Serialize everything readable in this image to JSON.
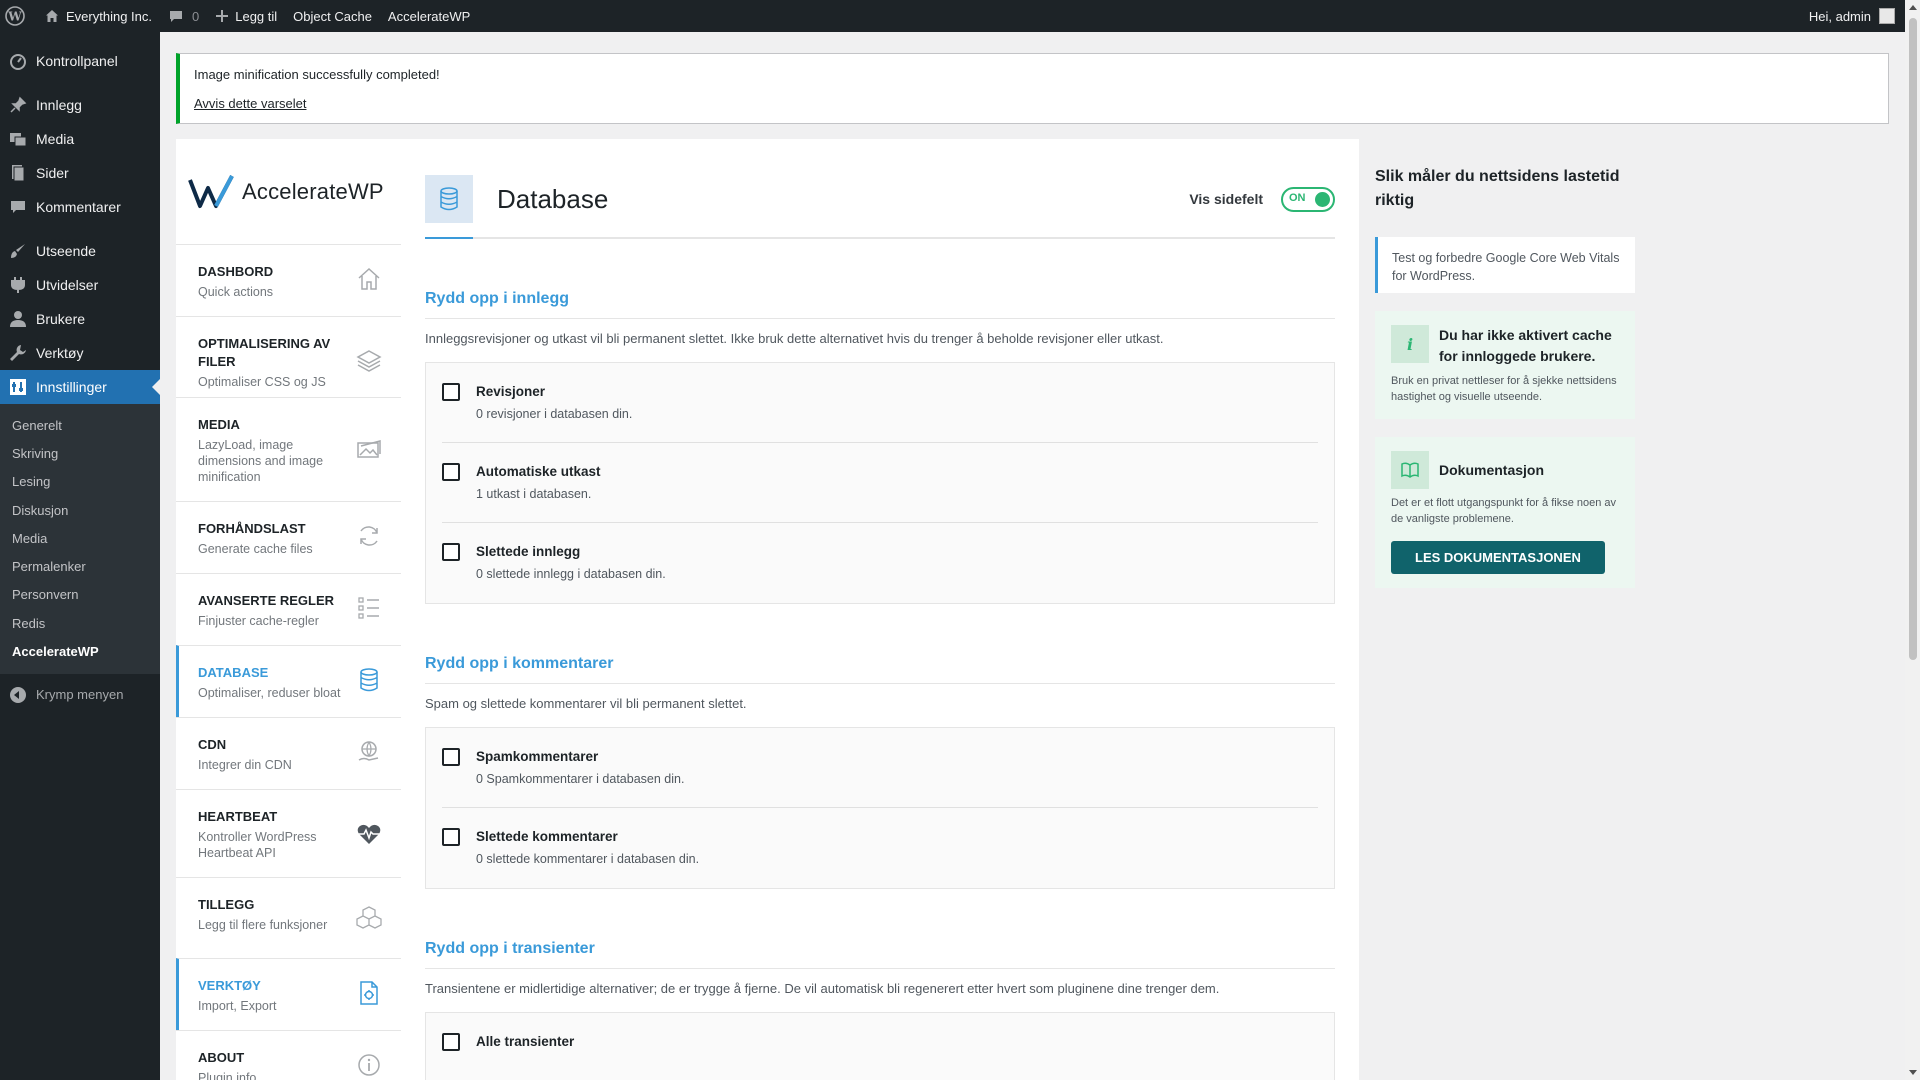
{
  "adminbar": {
    "site_name": "Everything Inc.",
    "comments_count": "0",
    "new_label": "Legg til",
    "object_cache_label": "Object Cache",
    "acceleratewp_label": "AccelerateWP",
    "greeting": "Hei, admin"
  },
  "adminmenu": {
    "items": [
      {
        "label": "Kontrollpanel",
        "icon": "dashboard-icon"
      },
      {
        "label": "Innlegg",
        "icon": "pin-icon"
      },
      {
        "label": "Media",
        "icon": "media-icon"
      },
      {
        "label": "Sider",
        "icon": "page-icon"
      },
      {
        "label": "Kommentarer",
        "icon": "comment-icon"
      },
      {
        "label": "Utseende",
        "icon": "brush-icon"
      },
      {
        "label": "Utvidelser",
        "icon": "plugin-icon"
      },
      {
        "label": "Brukere",
        "icon": "user-icon"
      },
      {
        "label": "Verktøy",
        "icon": "wrench-icon"
      },
      {
        "label": "Innstillinger",
        "icon": "settings-icon"
      }
    ],
    "submenu": [
      "Generelt",
      "Skriving",
      "Lesing",
      "Diskusjon",
      "Media",
      "Permalenker",
      "Personvern",
      "Redis",
      "AccelerateWP"
    ],
    "collapse_label": "Krymp menyen"
  },
  "notice": {
    "message": "Image minification successfully completed!",
    "dismiss": "Avvis dette varselet"
  },
  "plugin": {
    "logo_text": "AccelerateWP",
    "nav": [
      {
        "title": "DASHBORD",
        "desc": "Quick actions",
        "icon": "home-icon"
      },
      {
        "title": "OPTIMALISERING AV FILER",
        "desc": "Optimaliser CSS og JS",
        "icon": "layers-icon"
      },
      {
        "title": "MEDIA",
        "desc": "LazyLoad, image dimensions and image minification",
        "icon": "image-icon"
      },
      {
        "title": "FORHÅNDSLAST",
        "desc": "Generate cache files",
        "icon": "refresh-icon"
      },
      {
        "title": "AVANSERTE REGLER",
        "desc": "Finjuster cache-regler",
        "icon": "list-icon"
      },
      {
        "title": "DATABASE",
        "desc": "Optimaliser, reduser bloat",
        "icon": "database-icon"
      },
      {
        "title": "CDN",
        "desc": "Integrer din CDN",
        "icon": "globe-hand-icon"
      },
      {
        "title": "HEARTBEAT",
        "desc": "Kontroller WordPress Heartbeat API",
        "icon": "heartbeat-icon"
      },
      {
        "title": "TILLEGG",
        "desc": "Legg til flere funksjoner",
        "icon": "cubes-icon"
      },
      {
        "title": "VERKTØY",
        "desc": "Import, Export",
        "icon": "tools-doc-icon"
      },
      {
        "title": "ABOUT",
        "desc": "Plugin info",
        "icon": "info-icon"
      }
    ]
  },
  "main": {
    "title": "Database",
    "sidebar_toggle_label": "Vis sidefelt",
    "toggle_state": "ON",
    "sections": [
      {
        "heading": "Rydd opp i innlegg",
        "desc": "Innleggsrevisjoner og utkast vil bli permanent slettet. Ikke bruk dette alternativet hvis du trenger å beholde revisjoner eller utkast.",
        "options": [
          {
            "title": "Revisjoner",
            "desc": "0 revisjoner i databasen din."
          },
          {
            "title": "Automatiske utkast",
            "desc": "1 utkast i databasen."
          },
          {
            "title": "Slettede innlegg",
            "desc": "0 slettede innlegg i databasen din."
          }
        ]
      },
      {
        "heading": "Rydd opp i kommentarer",
        "desc": "Spam og slettede kommentarer vil bli permanent slettet.",
        "options": [
          {
            "title": "Spamkommentarer",
            "desc": "0 Spamkommentarer i databasen din."
          },
          {
            "title": "Slettede kommentarer",
            "desc": "0 slettede kommentarer i databasen din."
          }
        ]
      },
      {
        "heading": "Rydd opp i transienter",
        "desc": "Transientene er midlertidige alternativer; de er trygge å fjerne. De vil automatisk bli regenerert etter hvert som pluginene dine trenger dem.",
        "options": [
          {
            "title": "Alle transienter",
            "desc": ""
          }
        ]
      }
    ]
  },
  "side": {
    "title": "Slik måler du nettsidens lastetid riktig",
    "card1": "Test og forbedre Google Core Web Vitals for WordPress.",
    "card2": {
      "title": "Du har ikke aktivert cache for innloggede brukere.",
      "desc": "Bruk en privat nettleser for å sjekke nettsidens hastighet og visuelle utseende.",
      "icon_glyph": "i"
    },
    "card3": {
      "title": "Dokumentasjon",
      "desc": "Det er et flott utgangspunkt for å fikse noen av de vanligste problemene.",
      "button": "LES DOKUMENTASJONEN"
    }
  },
  "colors": {
    "accent": "#3a9ad9",
    "wp_admin_bg": "#1d2327",
    "wp_active": "#2271b1",
    "success": "#2bb673",
    "doc_button": "#10636b"
  }
}
